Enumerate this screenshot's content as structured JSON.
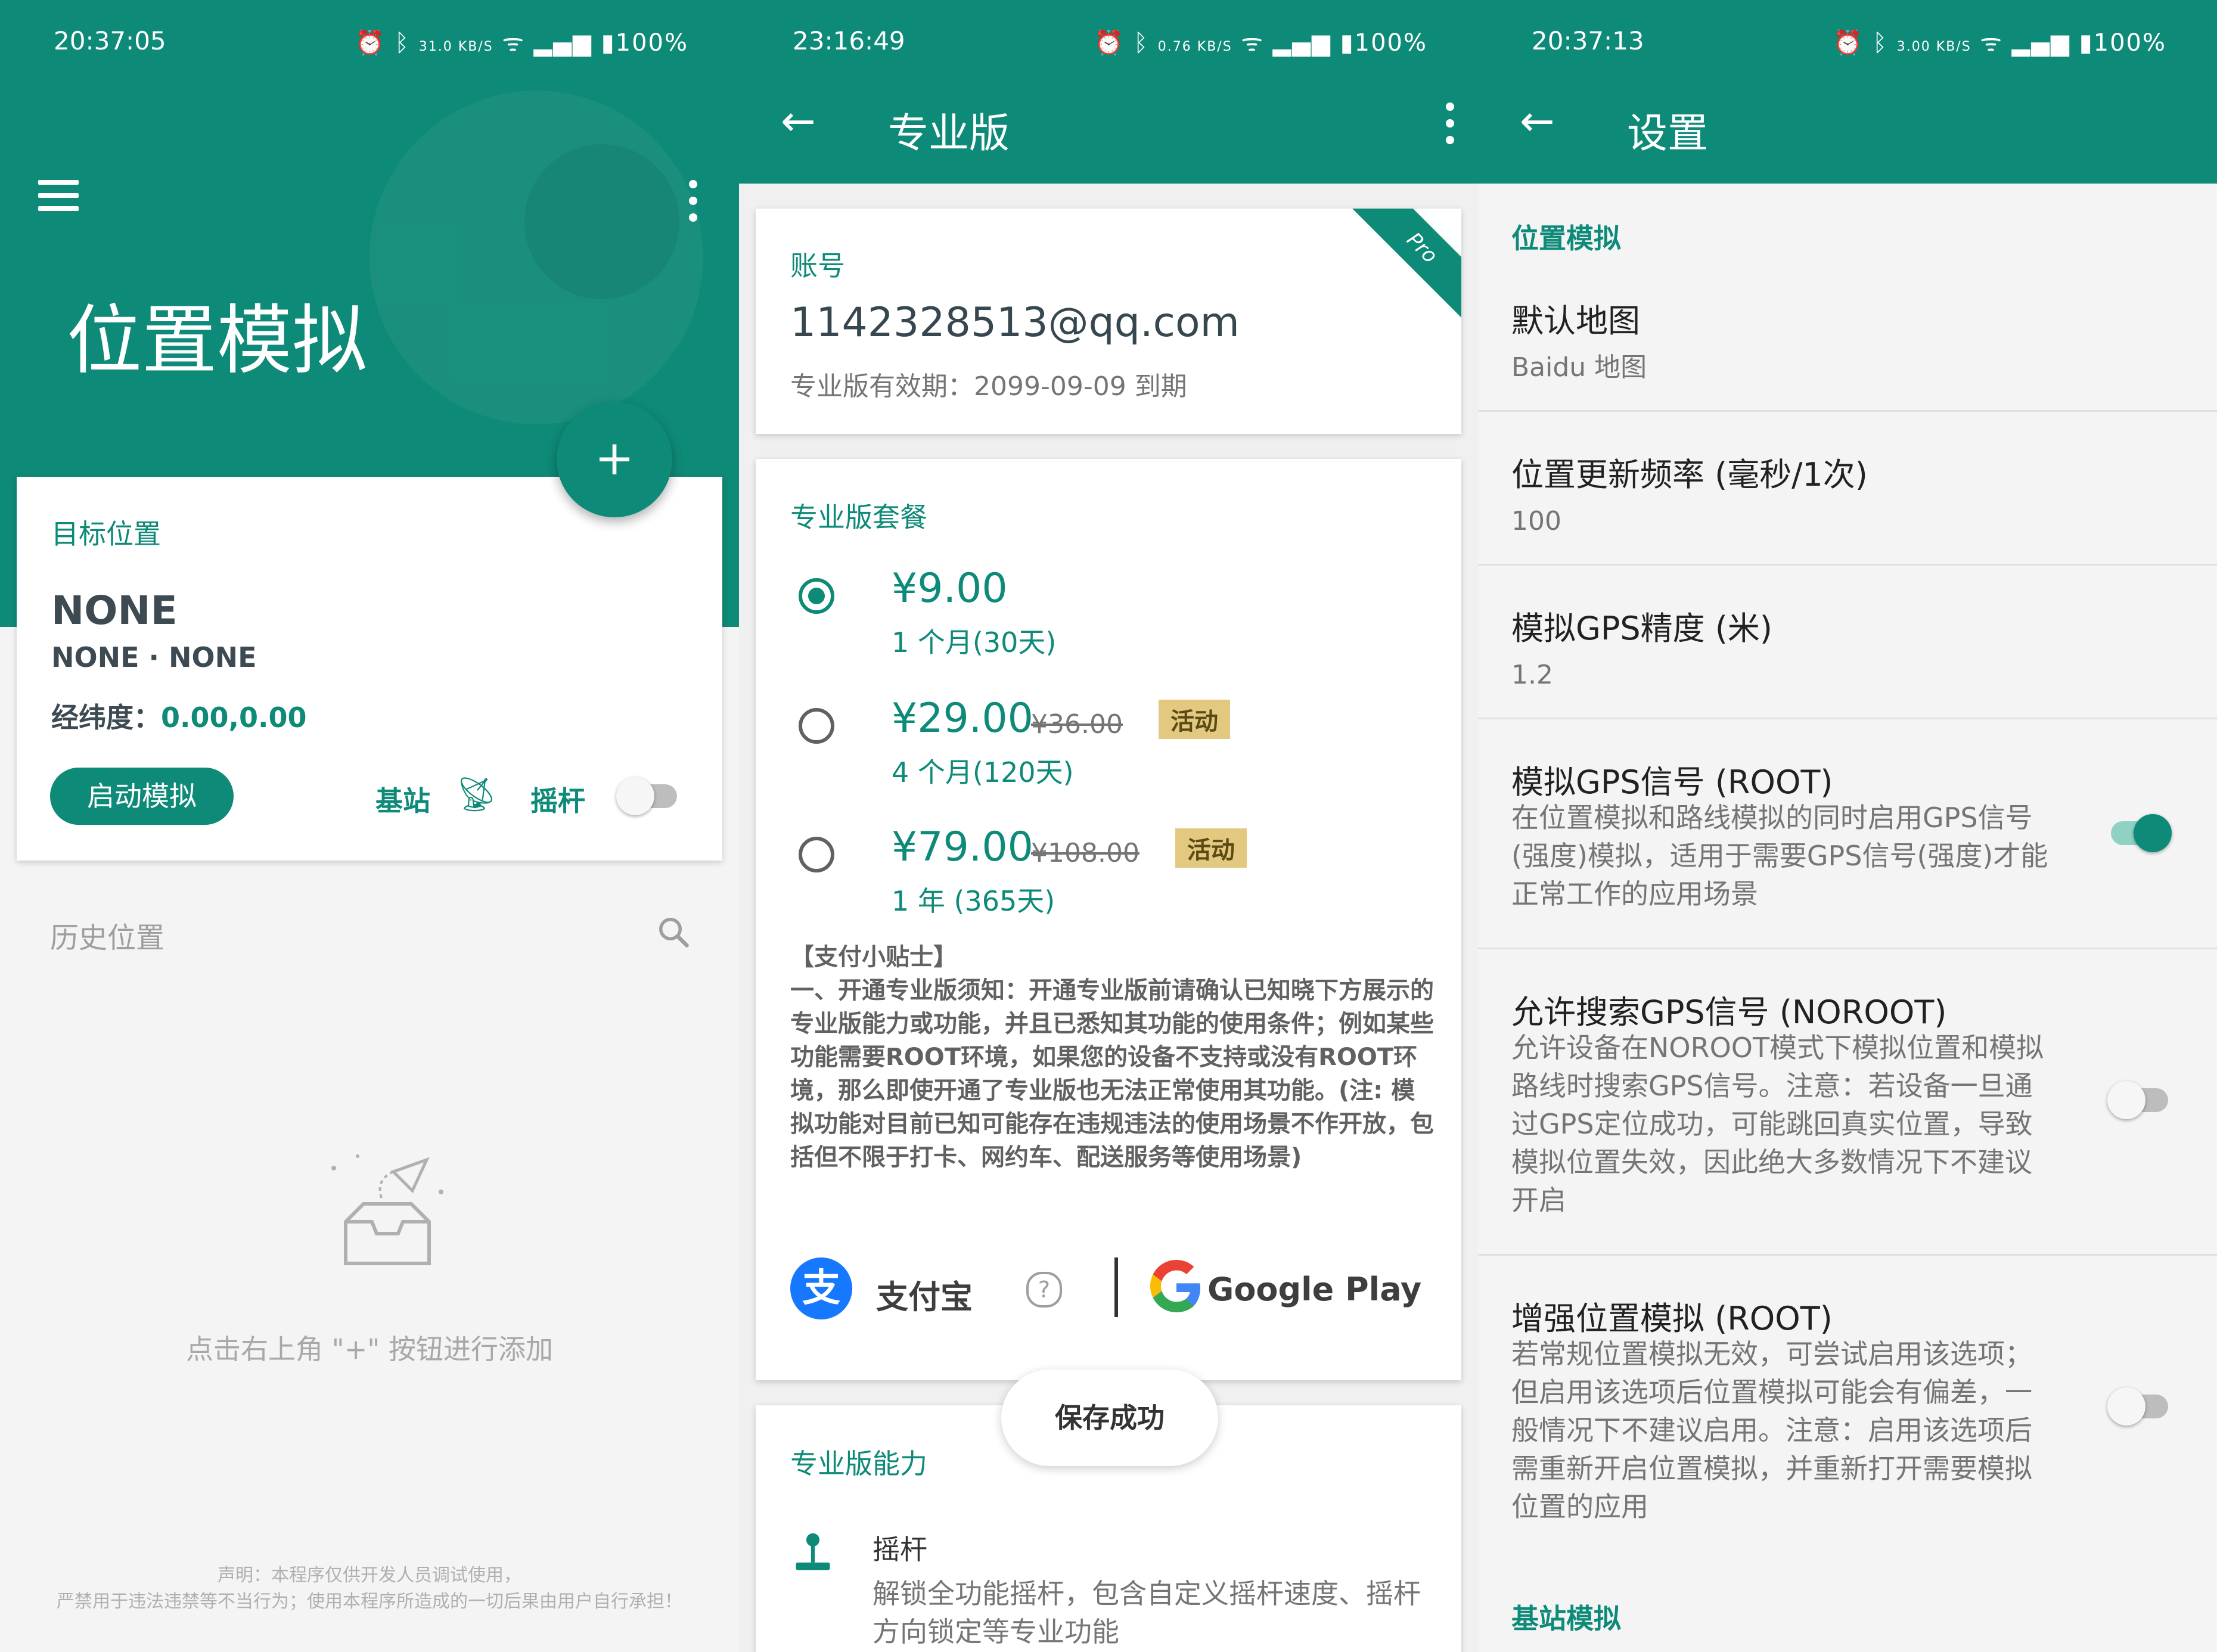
{
  "status_bars": [
    {
      "time": "20:37:05",
      "speed": "31.0 KB/S",
      "battery": "100%"
    },
    {
      "time": "23:16:49",
      "speed": "0.76 KB/S",
      "battery": "100%"
    },
    {
      "time": "20:37:13",
      "speed": "3.00 KB/S",
      "battery": "100%"
    }
  ],
  "home": {
    "title": "位置模拟",
    "fab_label": "+",
    "target": {
      "label": "目标位置",
      "name": "NONE",
      "sub": "NONE · NONE",
      "coord_label": "经纬度：",
      "coord_value": "0.00,0.00",
      "start_button": "启动模拟",
      "base_station": "基站",
      "joystick": "摇杆",
      "joystick_on": false
    },
    "history_label": "历史位置",
    "empty_hint": "点击右上角 \"+\" 按钮进行添加",
    "disclaimer_line1": "声明：本程序仅供开发人员调试使用，",
    "disclaimer_line2": "严禁用于违法违禁等不当行为；使用本程序所造成的一切后果由用户自行承担！"
  },
  "pro": {
    "title": "专业版",
    "back_icon": "←",
    "account": {
      "ribbon": "Pro",
      "label": "账号",
      "email": "1142328513@qq.com",
      "expiry": "专业版有效期：2099-09-09 到期"
    },
    "plans_header": "专业版套餐",
    "plans": [
      {
        "price": "¥9.00",
        "old_price": "",
        "badge": "",
        "duration": "1 个月(30天)",
        "selected": true
      },
      {
        "price": "¥29.00",
        "old_price": "¥36.00",
        "badge": "活动",
        "duration": "4 个月(120天)",
        "selected": false
      },
      {
        "price": "¥79.00",
        "old_price": "¥108.00",
        "badge": "活动",
        "duration": "1 年 (365天)",
        "selected": false
      }
    ],
    "tips": "【支付小贴士】\n一、开通专业版须知：开通专业版前请确认已知晓下方展示的专业版能力或功能，并且已悉知其功能的使用条件；例如某些功能需要ROOT环境，如果您的设备不支持或没有ROOT环境，那么即使开通了专业版也无法正常使用其功能。(注: 模拟功能对目前已知可能存在违规违法的使用场景不作开放，包括但不限于打卡、网约车、配送服务等使用场景)",
    "alipay": "支付宝",
    "alipay_glyph": "支",
    "help_glyph": "?",
    "google_play": "Google Play",
    "toast": "保存成功",
    "capabilities_header": "专业版能力",
    "capability": {
      "title": "摇杆",
      "desc": "解锁全功能摇杆，包含自定义摇杆速度、摇杆方向锁定等专业功能"
    }
  },
  "settings": {
    "title": "设置",
    "back_icon": "←",
    "section1": "位置模拟",
    "items": [
      {
        "title": "默认地图",
        "sub": "Baidu 地图"
      },
      {
        "title": "位置更新频率 (毫秒/1次)",
        "sub": "100"
      },
      {
        "title": "模拟GPS精度 (米)",
        "sub": "1.2"
      },
      {
        "title": "模拟GPS信号 (ROOT)",
        "desc": "在位置模拟和路线模拟的同时启用GPS信号(强度)模拟，适用于需要GPS信号(强度)才能正常工作的应用场景",
        "on": true
      },
      {
        "title": "允许搜索GPS信号 (NOROOT)",
        "desc": "允许设备在NOROOT模式下模拟位置和模拟路线时搜索GPS信号。注意：若设备一旦通过GPS定位成功，可能跳回真实位置，导致模拟位置失效，因此绝大多数情况下不建议开启",
        "on": false
      },
      {
        "title": "增强位置模拟 (ROOT)",
        "desc": "若常规位置模拟无效，可尝试启用该选项；但启用该选项后位置模拟可能会有偏差，一般情况下不建议启用。注意：启用该选项后需重新开启位置模拟，并重新打开需要模拟位置的应用",
        "on": false
      }
    ],
    "section2": "基站模拟"
  },
  "colors": {
    "primary": "#0e8a78",
    "badge": "#e3c87f",
    "alipay": "#1677ff"
  }
}
